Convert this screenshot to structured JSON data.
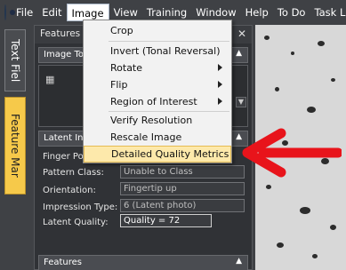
{
  "menubar": {
    "items": [
      {
        "label": "File"
      },
      {
        "label": "Edit"
      },
      {
        "label": "Image"
      },
      {
        "label": "View"
      },
      {
        "label": "Training"
      },
      {
        "label": "Window"
      },
      {
        "label": "Help"
      },
      {
        "label": "To Do"
      },
      {
        "label": "Task L"
      }
    ]
  },
  "side_tabs": [
    "Text Fiel",
    "Feature Mar"
  ],
  "panel": {
    "title": "Features T",
    "close": "✕",
    "image_tools_label": "Image To",
    "latent_label": "Latent Inf",
    "features_label": "Features",
    "fields": [
      {
        "label": "Finger Pos",
        "value": ""
      },
      {
        "label": "Pattern Class:",
        "value": "Unable to Class"
      },
      {
        "label": "Orientation:",
        "value": "Fingertip up"
      },
      {
        "label": "Impression Type:",
        "value": "6 (Latent photo)"
      },
      {
        "label": "Latent Quality:",
        "value": "Quality = 72"
      }
    ]
  },
  "image_menu": {
    "items": [
      {
        "label": "Crop",
        "submenu": false,
        "highlighted": false
      },
      {
        "label": "Invert (Tonal Reversal)",
        "submenu": false,
        "highlighted": false
      },
      {
        "label": "Rotate",
        "submenu": true,
        "highlighted": false
      },
      {
        "label": "Flip",
        "submenu": true,
        "highlighted": false
      },
      {
        "label": "Region of Interest",
        "submenu": true,
        "highlighted": false
      },
      {
        "label": "Verify Resolution",
        "submenu": false,
        "highlighted": false
      },
      {
        "label": "Rescale Image",
        "submenu": false,
        "highlighted": false
      },
      {
        "label": "Detailed Quality Metrics",
        "submenu": false,
        "highlighted": true
      }
    ]
  },
  "annotation": {
    "arrow_color": "#e8141b"
  }
}
